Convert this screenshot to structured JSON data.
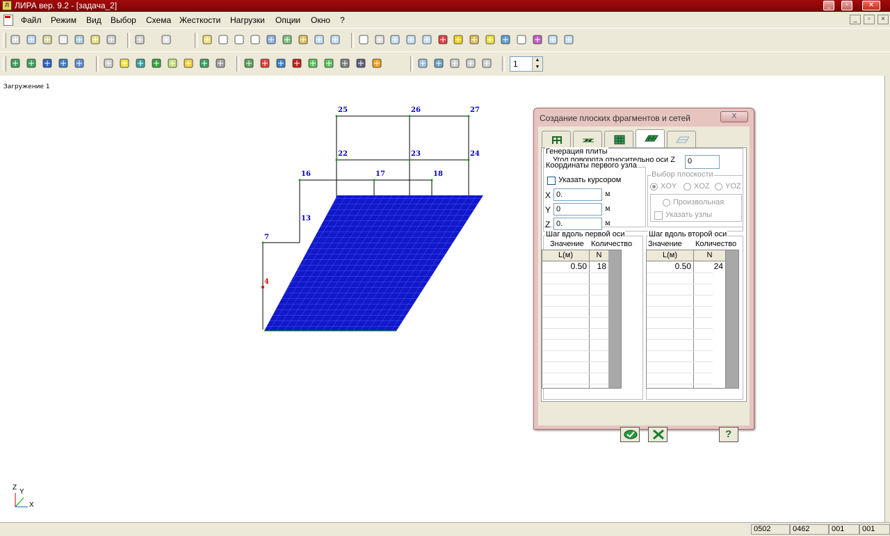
{
  "window": {
    "title": "ЛИРА  вер. 9.2 - [задача_2]",
    "app_icon_label": "Л"
  },
  "menu": [
    {
      "label": "Файл",
      "key": "Ф"
    },
    {
      "label": "Режим",
      "key": "Р"
    },
    {
      "label": "Вид",
      "key": "В"
    },
    {
      "label": "Выбор",
      "key": "б"
    },
    {
      "label": "Схема",
      "key": "С"
    },
    {
      "label": "Жесткости",
      "key": "Ж"
    },
    {
      "label": "Нагрузки",
      "key": "Н"
    },
    {
      "label": "Опции",
      "key": "О"
    },
    {
      "label": "Окно",
      "key": "О"
    },
    {
      "label": "?",
      "key": "?"
    }
  ],
  "toolbar": {
    "load_case_value": "1"
  },
  "canvas": {
    "load_case_label": "Загружение  1",
    "node_labels": [
      "25",
      "26",
      "27",
      "22",
      "23",
      "24",
      "16",
      "17",
      "18",
      "13",
      "7",
      "4"
    ],
    "axes": {
      "z": "Z",
      "y": "Y",
      "x": "X"
    }
  },
  "dialog": {
    "title": "Создание плоских фрагментов и сетей",
    "close_glyph": "X",
    "plate_generation": "Генерация плиты",
    "rotation_label": "Угол поворота относительно оси Z",
    "rotation_value": "0",
    "first_node": "Координаты первого узла",
    "use_cursor": "Указать курсором",
    "coords": [
      {
        "label": "X",
        "value": "0.",
        "unit": "м"
      },
      {
        "label": "Y",
        "value": "0",
        "unit": "м"
      },
      {
        "label": "Z",
        "value": "0.",
        "unit": "м"
      }
    ],
    "plane": {
      "title": "Выбор плоскости",
      "options": [
        "XOY",
        "XOZ",
        "YOZ"
      ],
      "selected": "XOY",
      "arbitrary": "Произвольная",
      "specify_nodes": "Указать узлы"
    },
    "step_axis1": {
      "title": "Шаг вдоль первой оси",
      "col_value": "Значение",
      "col_count": "Количество",
      "h1": "L(м)",
      "h2": "N",
      "row": [
        "0.50",
        "18"
      ]
    },
    "step_axis2": {
      "title": "Шаг вдоль второй оси",
      "col_value": "Значение",
      "col_count": "Количество",
      "h1": "L(м)",
      "h2": "N",
      "row": [
        "0.50",
        "24"
      ]
    },
    "help_label": "?"
  },
  "status": [
    "0502",
    "0462",
    "001",
    "001"
  ]
}
